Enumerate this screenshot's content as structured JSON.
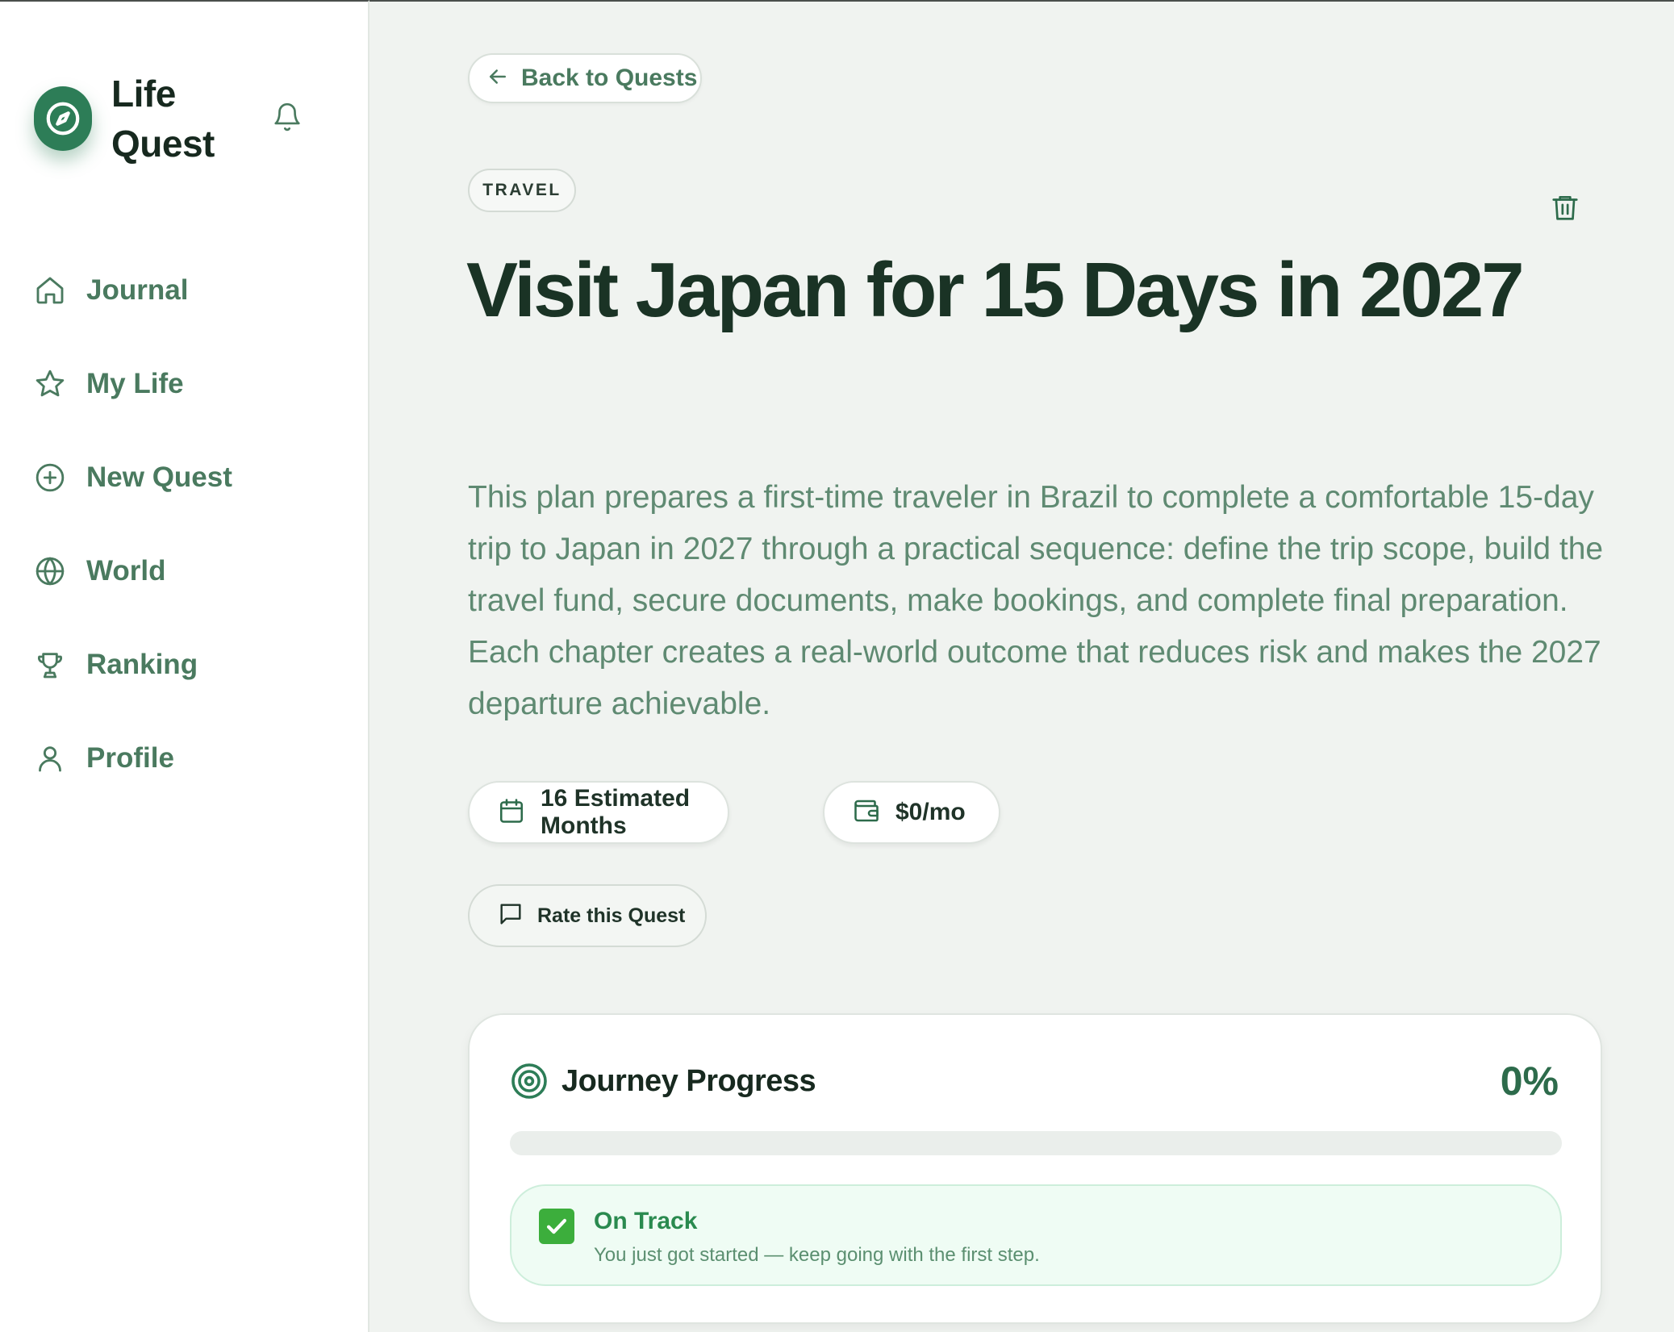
{
  "brand": {
    "name": "Life Quest",
    "logo_icon": "compass-icon",
    "accent": "#2d7d57"
  },
  "notifications": {
    "icon": "bell-icon"
  },
  "nav": {
    "items": [
      {
        "label": "Journal",
        "icon": "home-icon"
      },
      {
        "label": "My Life",
        "icon": "star-icon"
      },
      {
        "label": "New Quest",
        "icon": "plus-circle-icon"
      },
      {
        "label": "World",
        "icon": "globe-icon"
      },
      {
        "label": "Ranking",
        "icon": "trophy-icon"
      },
      {
        "label": "Profile",
        "icon": "user-icon"
      }
    ]
  },
  "main": {
    "back_label": "Back to Quests",
    "category": "TRAVEL",
    "title": "Visit Japan for 15 Days in 2027",
    "description": "This plan prepares a first-time traveler in Brazil to complete a comfortable 15-day trip to Japan in 2027 through a practical sequence: define the trip scope, build the travel fund, secure documents, make bookings, and complete final preparation. Each chapter creates a real-world outcome that reduces risk and makes the 2027 departure achievable.",
    "chips": {
      "months": "16 Estimated Months",
      "budget": "$0/mo"
    },
    "rate_label": "Rate this Quest"
  },
  "progress": {
    "title": "Journey Progress",
    "percent_label": "0%",
    "percent_value": 0,
    "status_title": "On Track",
    "status_subtitle": "You just got started — keep going with the first step."
  }
}
